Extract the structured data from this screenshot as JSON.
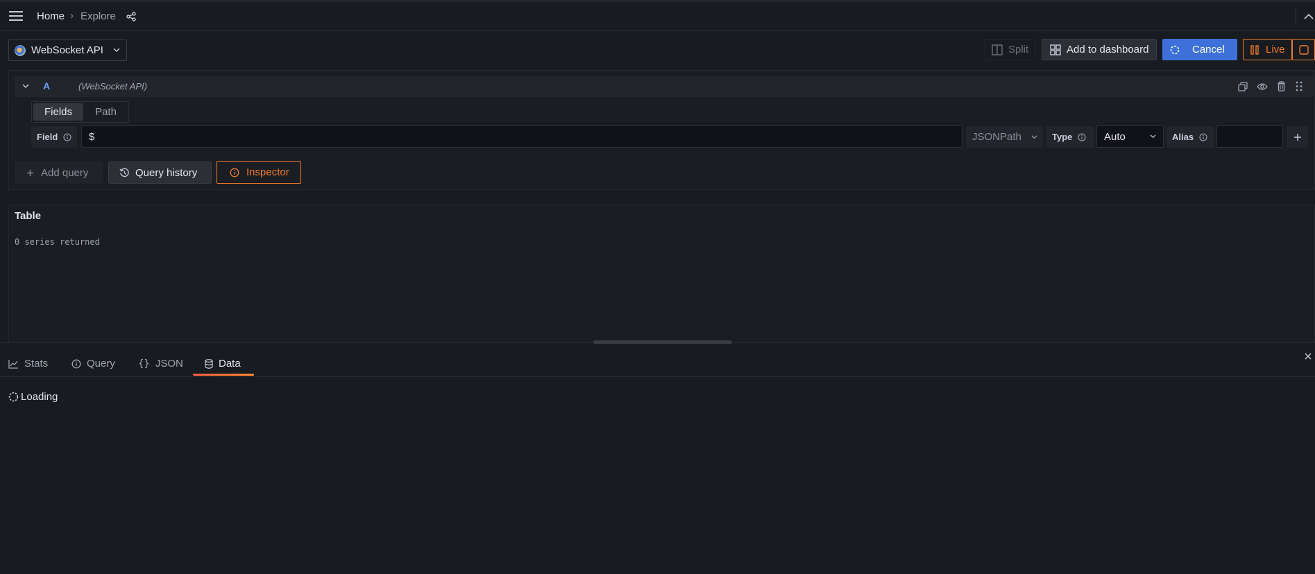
{
  "topbar": {
    "breadcrumb_home": "Home",
    "breadcrumb_sep": "›",
    "breadcrumb_current": "Explore"
  },
  "toolbar": {
    "datasource": "WebSocket API",
    "split_label": "Split",
    "add_dashboard_label": "Add to dashboard",
    "cancel_label": "Cancel",
    "live_label": "Live"
  },
  "query": {
    "ref_id": "A",
    "datasource_name": "(WebSocket API)",
    "tabs": [
      "Fields",
      "Path"
    ],
    "field_label": "Field",
    "field_value": "$",
    "jsonpath_label": "JSONPath",
    "type_label": "Type",
    "type_value": "Auto",
    "alias_label": "Alias",
    "alias_value": ""
  },
  "actions": {
    "add_query": "Add query",
    "query_history": "Query history",
    "inspector": "Inspector"
  },
  "table": {
    "title": "Table",
    "status": "0 series returned"
  },
  "inspector": {
    "tabs": [
      "Stats",
      "Query",
      "JSON",
      "Data"
    ],
    "active_tab": "Data",
    "loading_text": "Loading"
  },
  "colors": {
    "background": "#181b1f",
    "panel": "#1f2226",
    "primary": "#3d71d9",
    "accent_orange": "#f07c2c",
    "ref_blue": "#6e9fff"
  }
}
